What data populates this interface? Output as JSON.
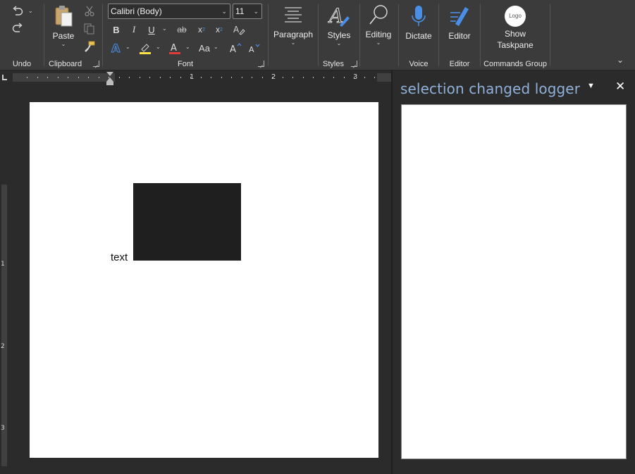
{
  "ribbon": {
    "undo_group": {
      "label": "Undo"
    },
    "clipboard_group": {
      "label": "Clipboard",
      "paste_label": "Paste"
    },
    "font_group": {
      "label": "Font",
      "font_name": "Calibri (Body)",
      "font_size": "11",
      "bold": "B",
      "italic": "I",
      "underline": "U",
      "strikethrough": "ab",
      "subscript": "x",
      "superscript": "x",
      "change_case": "Aa"
    },
    "paragraph_group": {
      "label": "Paragraph"
    },
    "styles_group": {
      "label": "Styles",
      "styles_button": "Styles"
    },
    "editing_group": {
      "label": "Editing"
    },
    "voice_group": {
      "label": "Voice",
      "dictate_button": "Dictate"
    },
    "editor_group": {
      "label": "Editor",
      "editor_button": "Editor"
    },
    "commands_group": {
      "label": "Commands Group",
      "show_taskpane_line1": "Show",
      "show_taskpane_line2": "Taskpane",
      "logo_text": "Logo"
    }
  },
  "ruler": {
    "numbers": [
      "1",
      "2",
      "3"
    ],
    "vnumbers": [
      "1",
      "2",
      "3"
    ]
  },
  "document": {
    "text": "text"
  },
  "taskpane": {
    "title": "selection changed logger"
  },
  "colors": {
    "ribbon_bg": "#3b3b3b",
    "pane_title": "#8fb1d9",
    "accent_blue": "#4a8fe7",
    "highlight_yellow": "#ffe14a",
    "font_red": "#e03c3c"
  }
}
